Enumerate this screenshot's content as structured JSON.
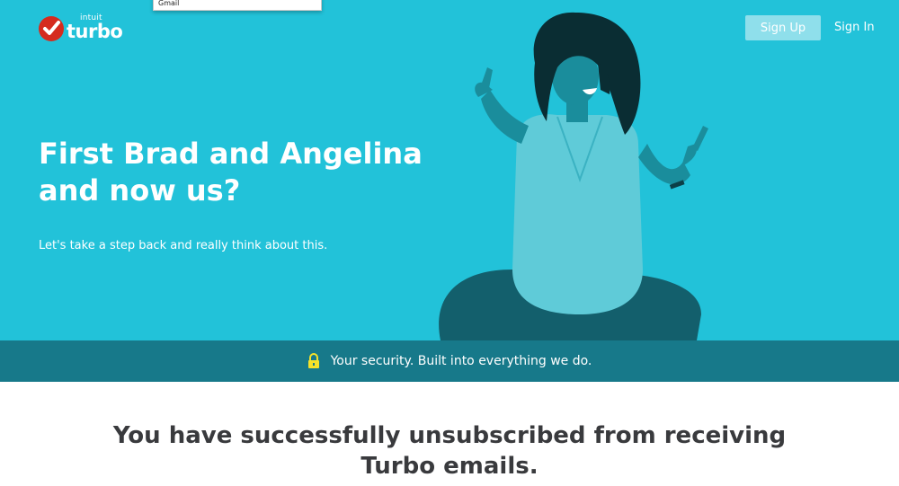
{
  "header": {
    "logo_brand": "intuit",
    "logo_product": "turbo",
    "signup_label": "Sign Up",
    "signin_label": "Sign In"
  },
  "autocomplete": {
    "item": "Gmail"
  },
  "hero": {
    "headline": "First Brad and Angelina and now us?",
    "subhead": "Let's take a step back and really think about this."
  },
  "security_banner": {
    "text": "Your security. Built into everything we do.",
    "icon": "lock-icon"
  },
  "main": {
    "message": "You have successfully unsubscribed from receiving Turbo emails."
  },
  "colors": {
    "hero_bg": "#22c2d9",
    "banner_bg": "#17798a",
    "signup_bg": "#8fdfeb",
    "logo_red": "#d52b1e",
    "lock_yellow": "#f5e22a",
    "heading_text": "#393a3d"
  }
}
